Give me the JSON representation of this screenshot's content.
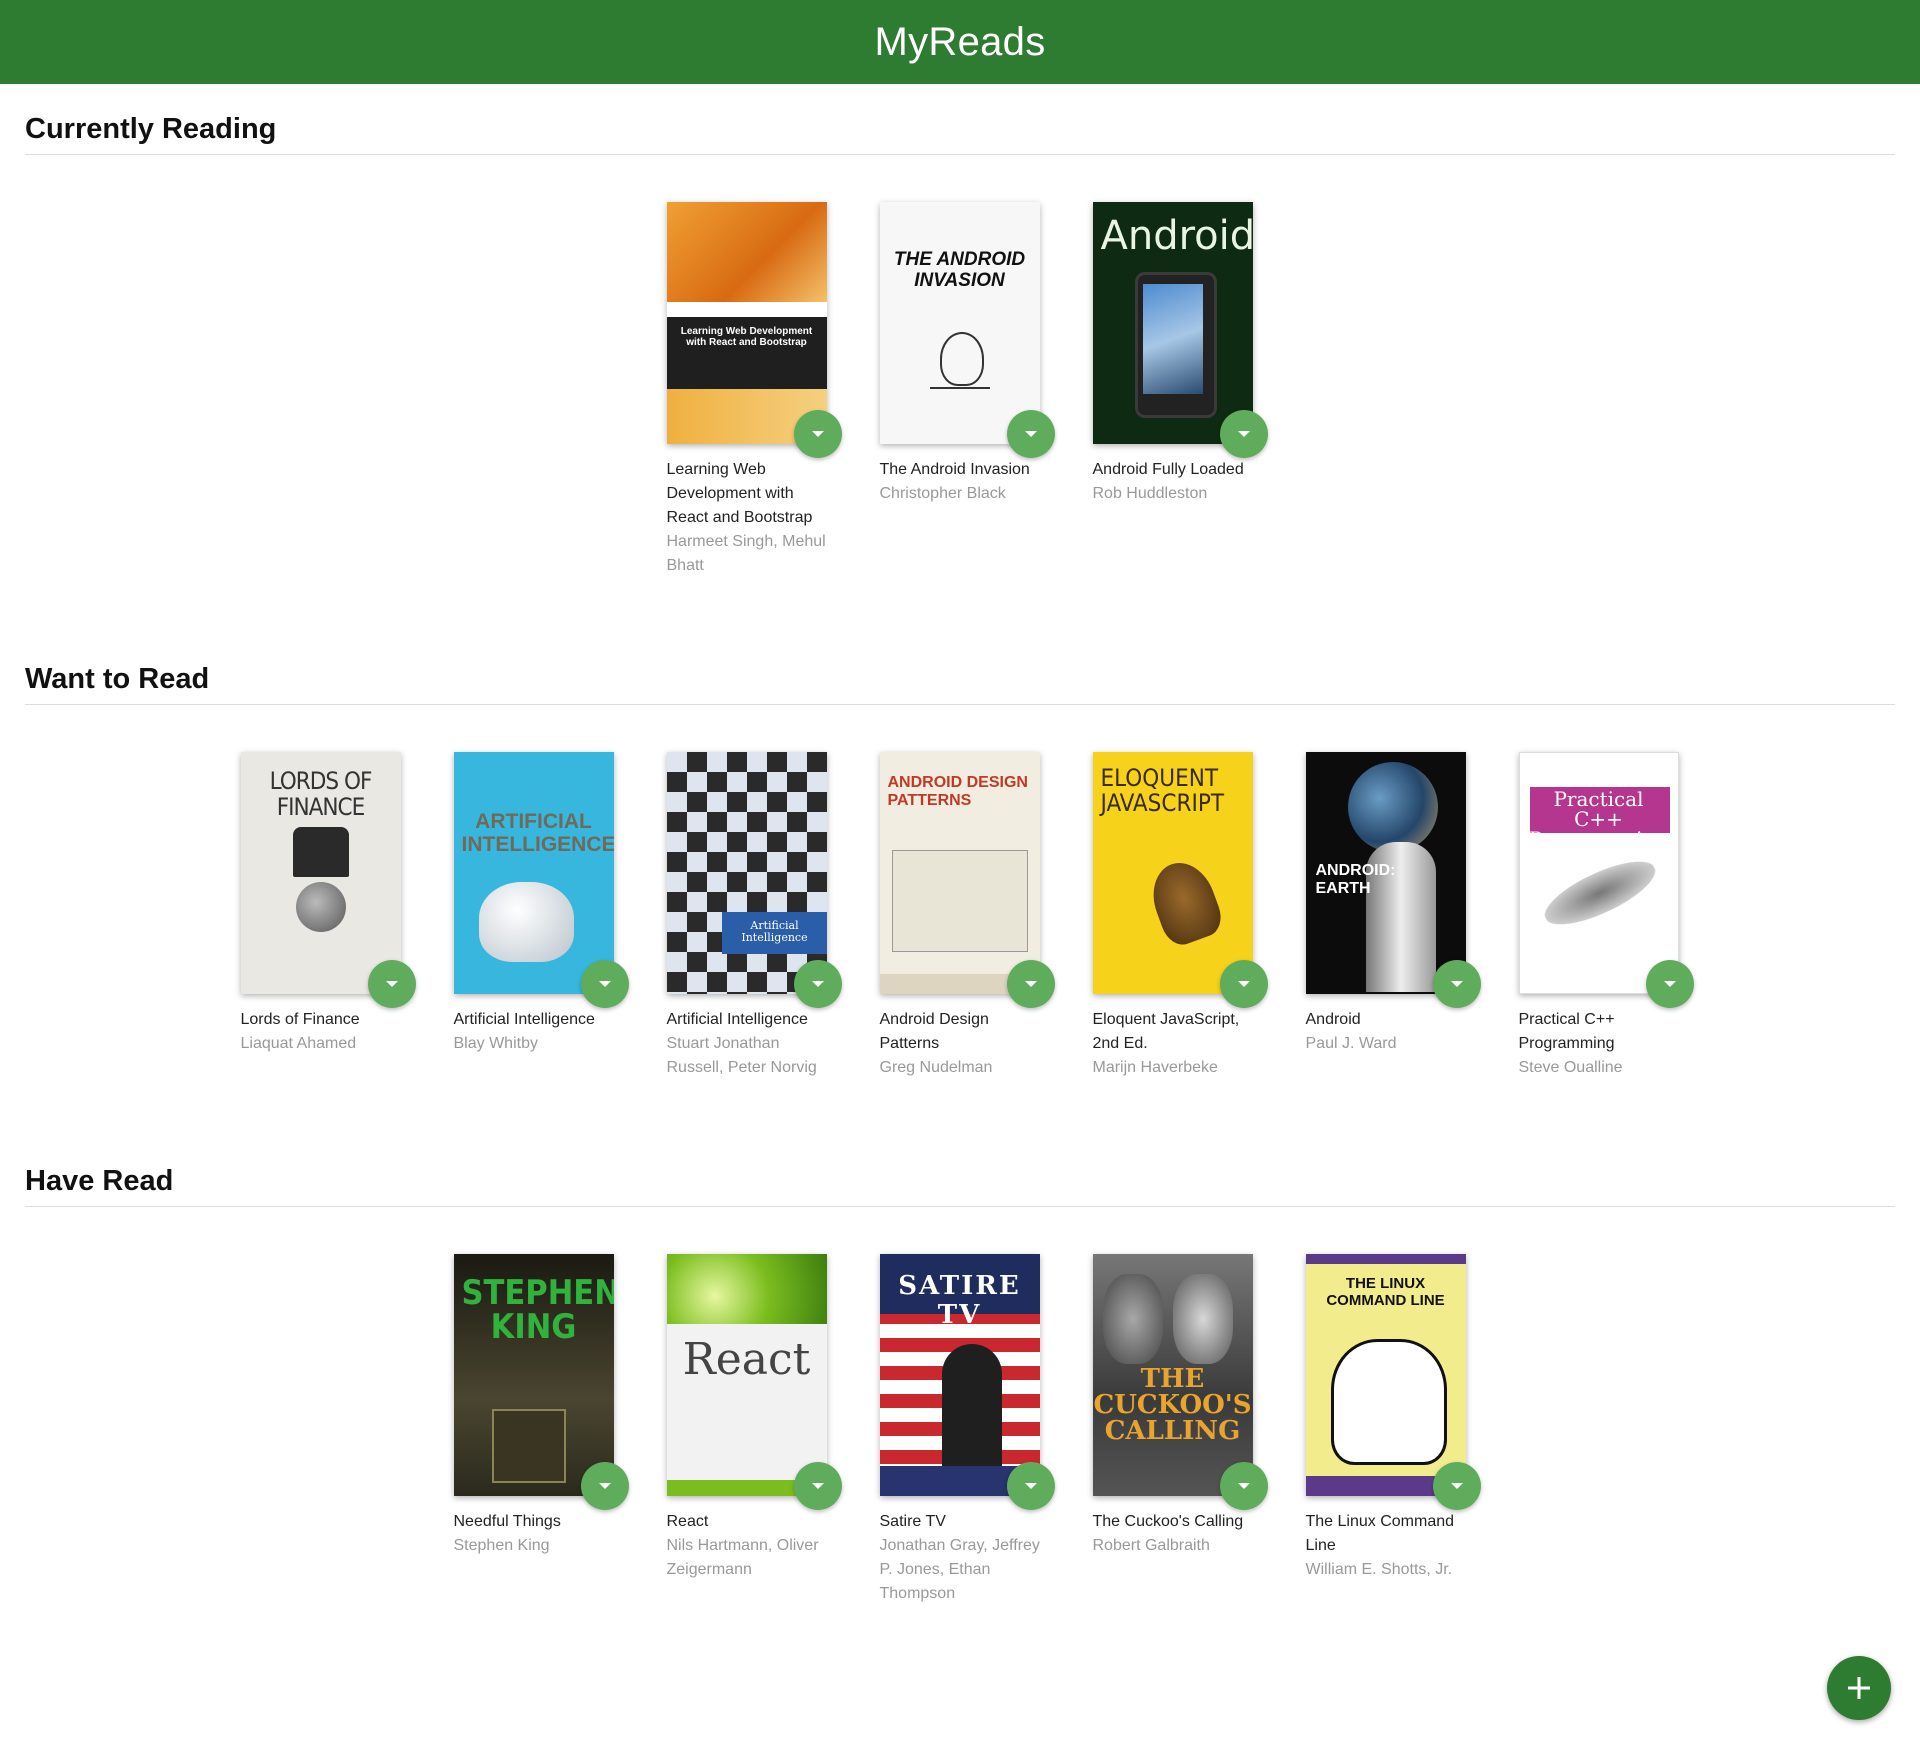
{
  "app": {
    "title": "MyReads"
  },
  "shelves": [
    {
      "title": "Currently Reading",
      "books": [
        {
          "title": "Learning Web Development with React and Bootstrap",
          "authors": "Harmeet Singh, Mehul Bhatt",
          "cover": {
            "bg": "#e8891b",
            "accent": "#1f1f1f",
            "text": "Learning Web Development with React and Bootstrap",
            "fg": "#ffffff"
          }
        },
        {
          "title": "The Android Invasion",
          "authors": "Christopher Black",
          "cover": {
            "bg": "#f7f7f7",
            "accent": "#cccccc",
            "text": "THE ANDROID INVASION",
            "fg": "#111111"
          }
        },
        {
          "title": "Android Fully Loaded",
          "authors": "Rob Huddleston",
          "cover": {
            "bg": "#0f2a12",
            "accent": "#2c5a2f",
            "text": "Android",
            "fg": "#e8f5e0"
          }
        }
      ]
    },
    {
      "title": "Want to Read",
      "books": [
        {
          "title": "Lords of Finance",
          "authors": "Liaquat Ahamed",
          "cover": {
            "bg": "#e9e8e2",
            "accent": "#8a8a8a",
            "text": "LORDS OF FINANCE",
            "fg": "#333333"
          }
        },
        {
          "title": "Artificial Intelligence",
          "authors": "Blay Whitby",
          "cover": {
            "bg": "#38b7de",
            "accent": "#eeeeee",
            "text": "ARTIFICIAL INTELLIGENCE",
            "fg": "#6f6a5a"
          }
        },
        {
          "title": "Artificial Intelligence",
          "authors": "Stuart Jonathan Russell, Peter Norvig",
          "cover": {
            "bg": "#dfe5ee",
            "accent": "#2a5ea8",
            "text": "Artificial Intelligence",
            "fg": "#ffffff"
          }
        },
        {
          "title": "Android Design Patterns",
          "authors": "Greg Nudelman",
          "cover": {
            "bg": "#f1ede0",
            "accent": "#c23a26",
            "text": "ANDROID DESIGN PATTERNS",
            "fg": "#c23a26"
          }
        },
        {
          "title": "Eloquent JavaScript, 2nd Ed.",
          "authors": "Marijn Haverbeke",
          "cover": {
            "bg": "#f7d21a",
            "accent": "#7a4b1c",
            "text": "ELOQUENT JAVASCRIPT",
            "fg": "#3a2a10"
          }
        },
        {
          "title": "Android",
          "authors": "Paul J. Ward",
          "cover": {
            "bg": "#0c0c0c",
            "accent": "#c9c9c9",
            "text": "ANDROID: EARTH",
            "fg": "#ffffff"
          }
        },
        {
          "title": "Practical C++ Programming",
          "authors": "Steve Oualline",
          "cover": {
            "bg": "#ffffff",
            "accent": "#b5368e",
            "text": "Practical C++ Programming",
            "fg": "#ffffff"
          }
        }
      ]
    },
    {
      "title": "Have Read",
      "books": [
        {
          "title": "Needful Things",
          "authors": "Stephen King",
          "cover": {
            "bg": "#2b2a1d",
            "accent": "#8d8456",
            "text": "STEPHEN KING",
            "fg": "#2fb33d"
          }
        },
        {
          "title": "React",
          "authors": "Nils Hartmann, Oliver Zeigermann",
          "cover": {
            "bg": "#f2f2f2",
            "accent": "#7bbd1e",
            "text": "React",
            "fg": "#444444"
          }
        },
        {
          "title": "Satire TV",
          "authors": "Jonathan Gray, Jeffrey P. Jones, Ethan Thompson",
          "cover": {
            "bg": "#c8282e",
            "accent": "#27346e",
            "text": "SATIRE TV",
            "fg": "#ffffff"
          }
        },
        {
          "title": "The Cuckoo's Calling",
          "authors": "Robert Galbraith",
          "cover": {
            "bg": "#4e4e4e",
            "accent": "#d79a2a",
            "text": "THE CUCKOO'S CALLING",
            "fg": "#e9a42d"
          }
        },
        {
          "title": "The Linux Command Line",
          "authors": "William E. Shotts, Jr.",
          "cover": {
            "bg": "#f3ec8c",
            "accent": "#5b3a8a",
            "text": "THE LINUX COMMAND LINE",
            "fg": "#111111"
          }
        }
      ]
    }
  ],
  "icons": {
    "shelf_changer": "caret-down-icon",
    "add": "plus-icon"
  },
  "colors": {
    "header": "#2e7c31",
    "shelf_changer": "#60ac5d",
    "add_button": "#2e7c31"
  }
}
